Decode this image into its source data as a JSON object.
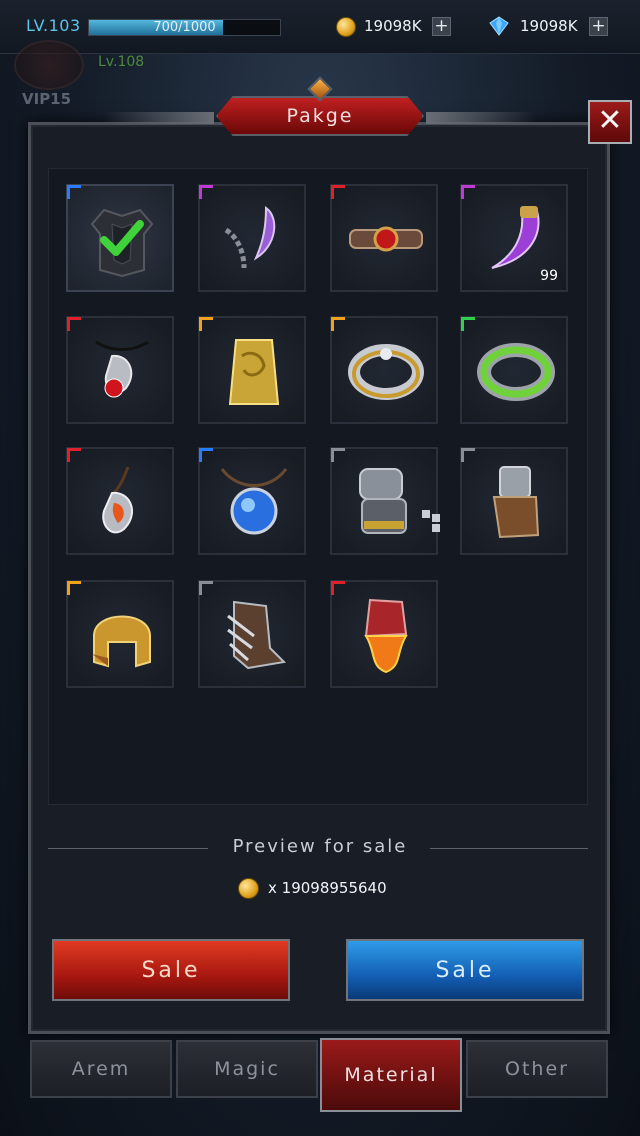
{
  "header": {
    "level_label": "LV.103",
    "xp_text": "700/1000",
    "xp_progress": 0.7,
    "gold_value": "19098K",
    "gem_value": "19098K",
    "plus_symbol": "+",
    "background_level": "Lv.108",
    "background_vip": "VIP15"
  },
  "panel": {
    "title": "Pakge",
    "close_symbol": "✕"
  },
  "colors": {
    "rarity_blue": "#2a7cff",
    "rarity_purple": "#c23ad6",
    "rarity_red": "#e0202a",
    "rarity_gold": "#f0a21a",
    "rarity_green": "#2fd04a",
    "rarity_gray": "#8a8f97"
  },
  "items": [
    {
      "icon": "chest-armor-icon",
      "rarity": "blue",
      "selected": true
    },
    {
      "icon": "chain-blade-icon",
      "rarity": "purple"
    },
    {
      "icon": "ruby-belt-icon",
      "rarity": "red"
    },
    {
      "icon": "purple-fang-icon",
      "rarity": "purple",
      "count": "99"
    },
    {
      "icon": "dragon-amulet-icon",
      "rarity": "red"
    },
    {
      "icon": "golden-bracer-icon",
      "rarity": "gold"
    },
    {
      "icon": "silver-gold-ring-icon",
      "rarity": "gold"
    },
    {
      "icon": "green-band-ring-icon",
      "rarity": "green"
    },
    {
      "icon": "fire-pendant-icon",
      "rarity": "red"
    },
    {
      "icon": "blue-orb-necklace-icon",
      "rarity": "blue"
    },
    {
      "icon": "steel-gauntlet-icon",
      "rarity": "gray"
    },
    {
      "icon": "leather-gauntlet-icon",
      "rarity": "gray"
    },
    {
      "icon": "golden-helmet-icon",
      "rarity": "gold"
    },
    {
      "icon": "blade-boots-icon",
      "rarity": "gray"
    },
    {
      "icon": "flame-gauntlet-icon",
      "rarity": "red"
    }
  ],
  "preview": {
    "label": "Preview for sale",
    "price_text": "x 19098955640"
  },
  "buttons": {
    "sale_red": "Sale",
    "sale_blue": "Sale"
  },
  "tabs": [
    {
      "label": "Arem",
      "active": false
    },
    {
      "label": "Magic",
      "active": false
    },
    {
      "label": "Material",
      "active": true
    },
    {
      "label": "Other",
      "active": false
    }
  ]
}
